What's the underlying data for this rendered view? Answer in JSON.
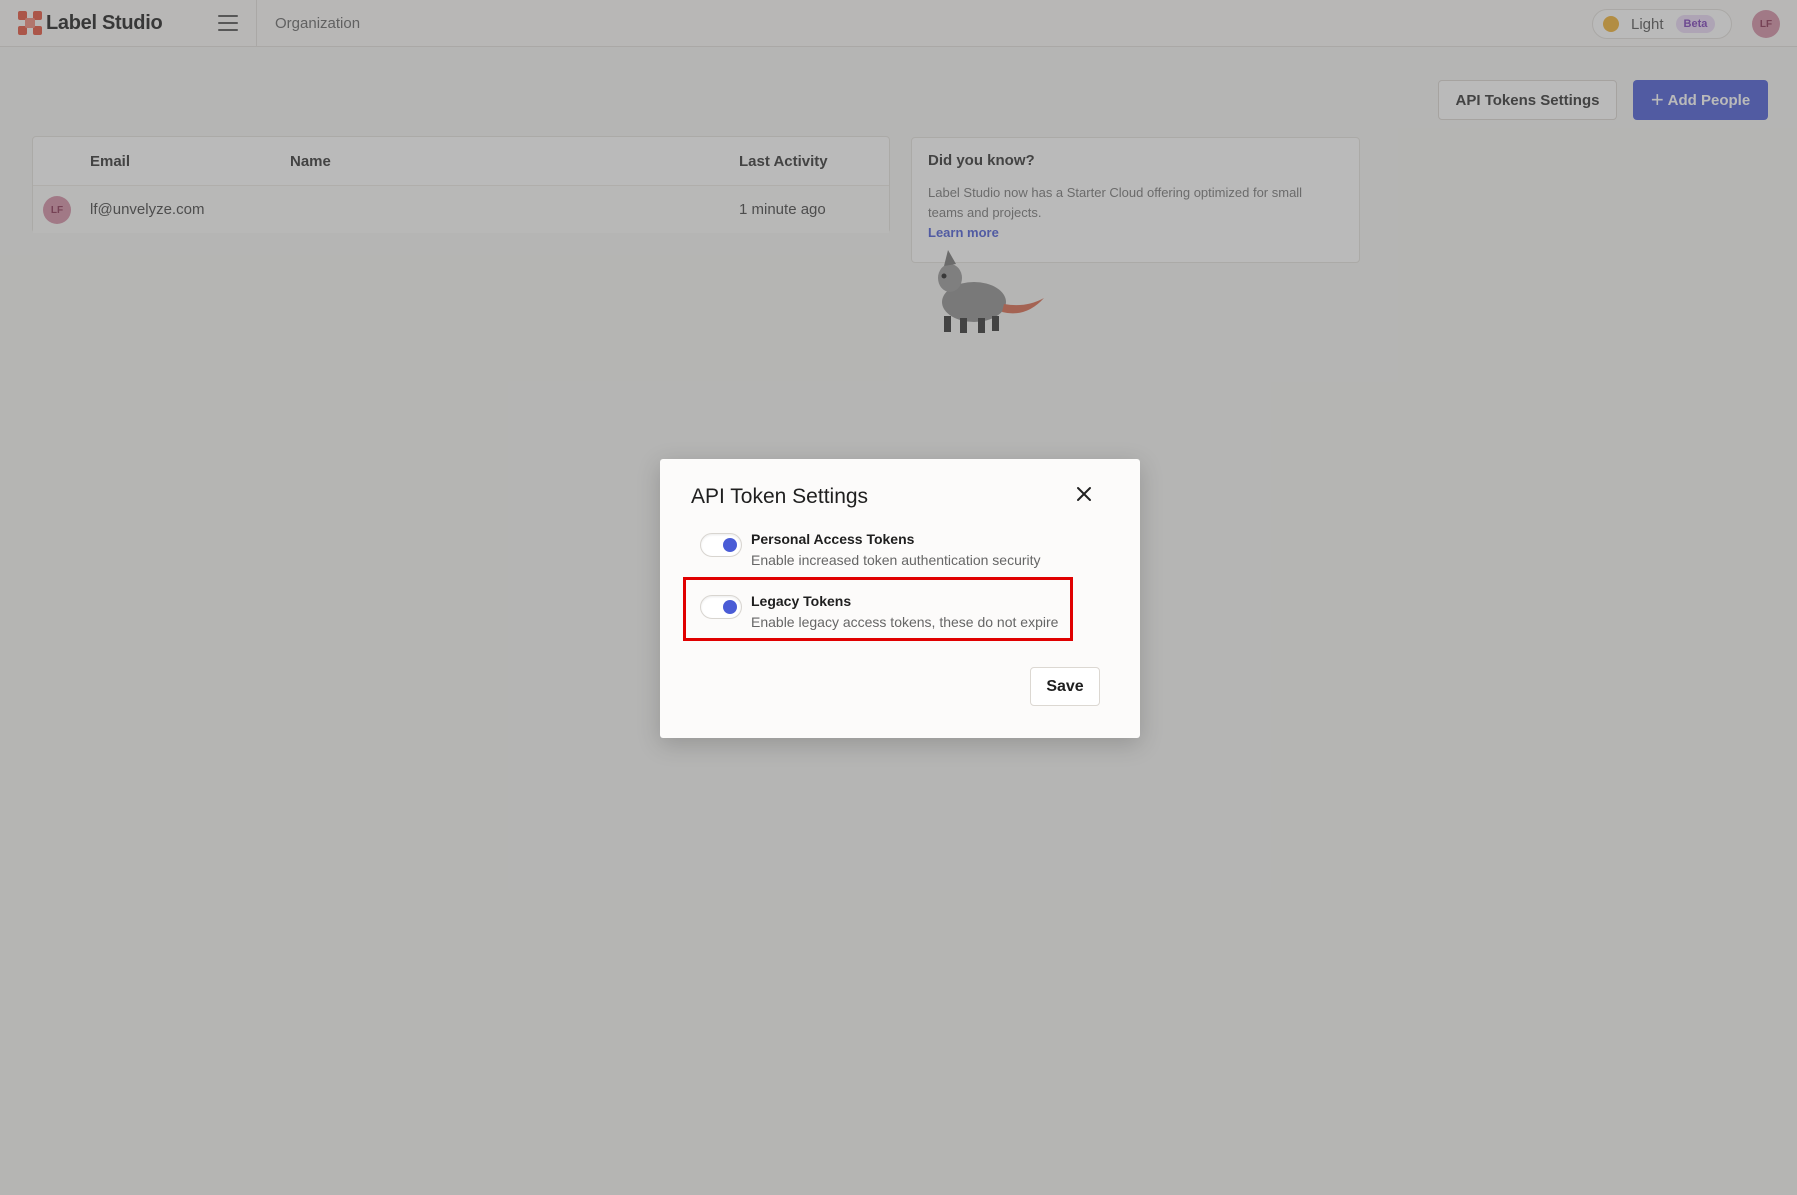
{
  "app": {
    "logo_text": "Label Studio",
    "breadcrumb": "Organization",
    "theme": {
      "label": "Light",
      "badge": "Beta"
    },
    "user_initials": "LF"
  },
  "toolbar": {
    "api_tokens_settings": "API Tokens Settings",
    "add_people": "Add People",
    "add_people_icon": "+"
  },
  "people_table": {
    "columns": [
      "Email",
      "Name",
      "Last Activity"
    ],
    "rows": [
      {
        "initials": "LF",
        "email": "lf@unvelyze.com",
        "name": "",
        "last_activity": "1 minute ago"
      }
    ]
  },
  "tip": {
    "title": "Did you know?",
    "body": "Label Studio now has a Starter Cloud offering optimized for small teams and projects.",
    "link": "Learn more"
  },
  "modal": {
    "title": "API Token Settings",
    "close_icon": "close-icon",
    "toggles": [
      {
        "label": "Personal Access Tokens",
        "description": "Enable increased token authentication security",
        "enabled": true
      },
      {
        "label": "Legacy Tokens",
        "description": "Enable legacy access tokens, these do not expire",
        "enabled": true
      }
    ],
    "save_label": "Save"
  },
  "colors": {
    "accent": "#4a5cd6",
    "highlight": "#e00000",
    "brand": "#e5533d"
  }
}
